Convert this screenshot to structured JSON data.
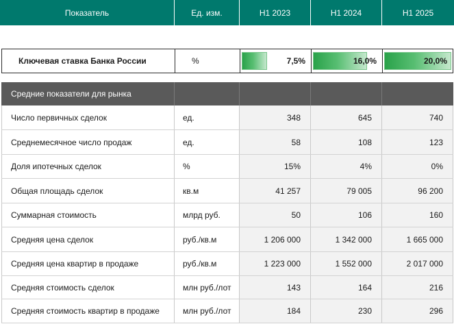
{
  "header": {
    "col_indicator": "Показатель",
    "col_unit": "Ед. изм.",
    "col_y1": "H1 2023",
    "col_y2": "H1 2024",
    "col_y3": "H1 2025"
  },
  "key_rate": {
    "label": "Ключевая ставка Банка России",
    "unit": "%",
    "values": [
      "7,5%",
      "16,0%",
      "20,0%"
    ],
    "bar_fill_fraction": [
      0.375,
      0.8,
      1.0
    ]
  },
  "section": {
    "label": "Средние показатели для рынка"
  },
  "rows": [
    {
      "label": "Число первичных сделок",
      "unit": "ед.",
      "v1": "348",
      "v2": "645",
      "v3": "740"
    },
    {
      "label": "Среднемесячное число продаж",
      "unit": "ед.",
      "v1": "58",
      "v2": "108",
      "v3": "123"
    },
    {
      "label": "Доля ипотечных сделок",
      "unit": "%",
      "v1": "15%",
      "v2": "4%",
      "v3": "0%"
    },
    {
      "label": "Общая площадь сделок",
      "unit": "кв.м",
      "v1": "41 257",
      "v2": "79 005",
      "v3": "96 200"
    },
    {
      "label": "Суммарная стоимость",
      "unit": "млрд руб.",
      "v1": "50",
      "v2": "106",
      "v3": "160"
    },
    {
      "label": "Средняя цена сделок",
      "unit": "руб./кв.м",
      "v1": "1 206 000",
      "v2": "1 342 000",
      "v3": "1 665 000"
    },
    {
      "label": "Средняя цена квартир в продаже",
      "unit": "руб./кв.м",
      "v1": "1 223 000",
      "v2": "1 552 000",
      "v3": "2 017 000"
    },
    {
      "label": "Средняя стоимость сделок",
      "unit": "млн руб./лот",
      "v1": "143",
      "v2": "164",
      "v3": "216"
    },
    {
      "label": "Средняя стоимость квартир в продаже",
      "unit": "млн руб./лот",
      "v1": "184",
      "v2": "230",
      "v3": "296"
    }
  ],
  "colors": {
    "header_bg": "#00796d",
    "section_bg": "#5a5a5a",
    "bar_green": "#2aa24a"
  }
}
